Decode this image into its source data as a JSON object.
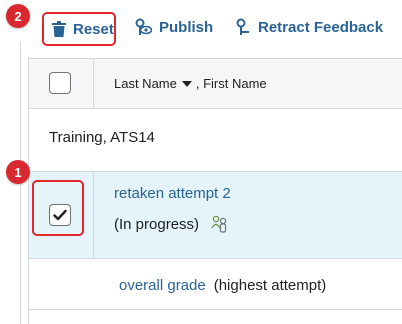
{
  "toolbar": {
    "reset_label": "Reset",
    "publish_label": "Publish",
    "retract_label": "Retract Feedback"
  },
  "table": {
    "header_label_primary": "Last Name",
    "header_label_secondary": ", First Name",
    "user_name": "Training, ATS14",
    "attempt": {
      "link": "retaken attempt 2",
      "status": "(In progress)",
      "checked": true
    },
    "grade": {
      "link": "overall grade",
      "note": "(highest attempt)"
    }
  },
  "annotations": {
    "badge_1": "1",
    "badge_2": "2",
    "color": "#d7292f"
  },
  "colors": {
    "link": "#2a6496",
    "selection": "#e5f3fb",
    "border": "#d6d8db"
  },
  "icons": {
    "reset": "trash-icon",
    "publish": "eye-icon",
    "retract": "retract-pin-icon",
    "sort": "sort-down-icon",
    "status": "users-icon",
    "checkmark": "checkmark-icon"
  }
}
